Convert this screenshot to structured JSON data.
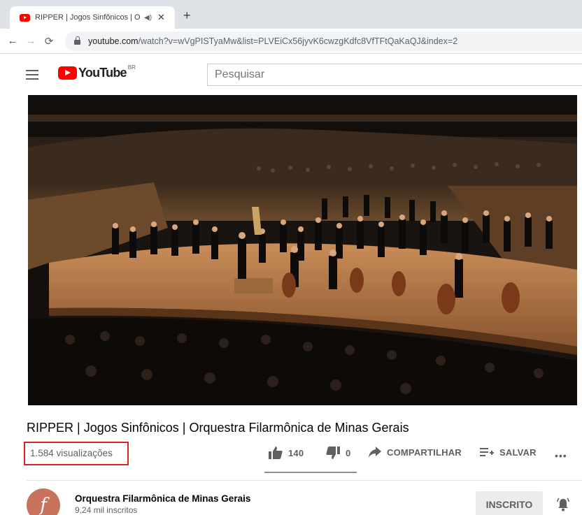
{
  "browser": {
    "tab_title": "RIPPER | Jogos Sinfônicos | Orquestra Filarmônica de Minas Gerais",
    "tab_audio_icon": "speaker-icon",
    "url_host": "youtube.com",
    "url_path": "/watch?v=wVgPISTyaMw&list=PLVEiCx56jyvK6cwzgKdfc8VfTFtQaKaQJ&index=2"
  },
  "masthead": {
    "logo_text": "YouTube",
    "country_code": "BR",
    "search_placeholder": "Pesquisar"
  },
  "video": {
    "title": "RIPPER | Jogos Sinfônicos | Orquestra Filarmônica de Minas Gerais",
    "views": "1.584 visualizações",
    "likes": "140",
    "dislikes": "0",
    "share_label": "COMPARTILHAR",
    "save_label": "SALVAR"
  },
  "channel": {
    "avatar_letter": "f",
    "name": "Orquestra Filarmônica de Minas Gerais",
    "subscribers": "9,24 mil inscritos",
    "subscribe_label": "INSCRITO"
  },
  "colors": {
    "brand_red": "#ff0000",
    "highlight_box": "#e02020",
    "avatar": "#c8735b"
  }
}
